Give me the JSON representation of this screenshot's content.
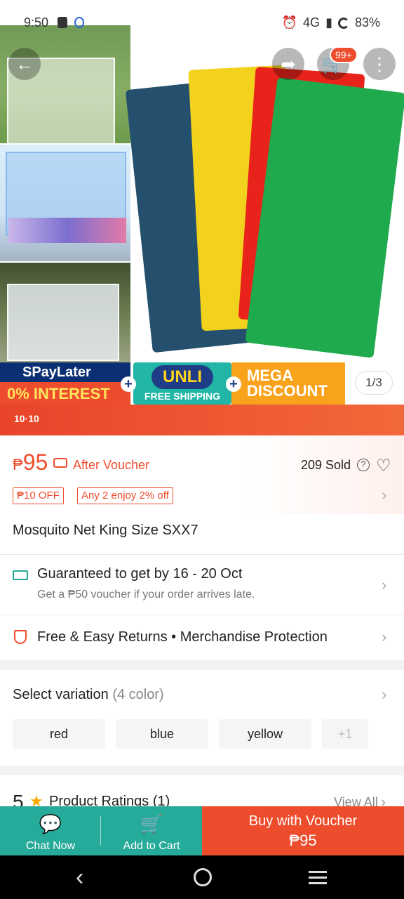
{
  "status_bar": {
    "time": "9:50",
    "network": "4G",
    "battery": "83%"
  },
  "gallery": {
    "page_indicator": "1/3"
  },
  "header": {
    "cart_badge": "99+"
  },
  "promo": {
    "spaylater": "SPayLater",
    "interest": "0% INTEREST",
    "unli": "UNLI",
    "free_shipping": "FREE SHIPPING",
    "mega": "MEGA",
    "discount": "DISCOUNT",
    "festival": "10·10"
  },
  "price": {
    "currency": "₱",
    "value": "95",
    "after_voucher": "After Voucher",
    "sold": "209 Sold",
    "tags": [
      "₱10 OFF",
      "Any 2 enjoy 2% off"
    ]
  },
  "product": {
    "title": "Mosquito Net King Size SXX7"
  },
  "shipping": {
    "main": "Guaranteed to get by 16 - 20 Oct",
    "sub": "Get a ₱50 voucher if your order arrives late."
  },
  "returns": {
    "text": "Free & Easy Returns  •  Merchandise Protection"
  },
  "variation": {
    "title": "Select variation",
    "count": "(4 color)",
    "options": [
      "red",
      "blue",
      "yellow",
      "+1"
    ]
  },
  "ratings": {
    "score": "5",
    "label": "Product Ratings (1)",
    "view_all": "View All"
  },
  "bottom": {
    "chat": "Chat Now",
    "add_cart": "Add to Cart",
    "buy_line1": "Buy with Voucher",
    "buy_line2": "₱95"
  },
  "colors": {
    "brand": "#ee4d2d",
    "teal": "#26aa99"
  }
}
